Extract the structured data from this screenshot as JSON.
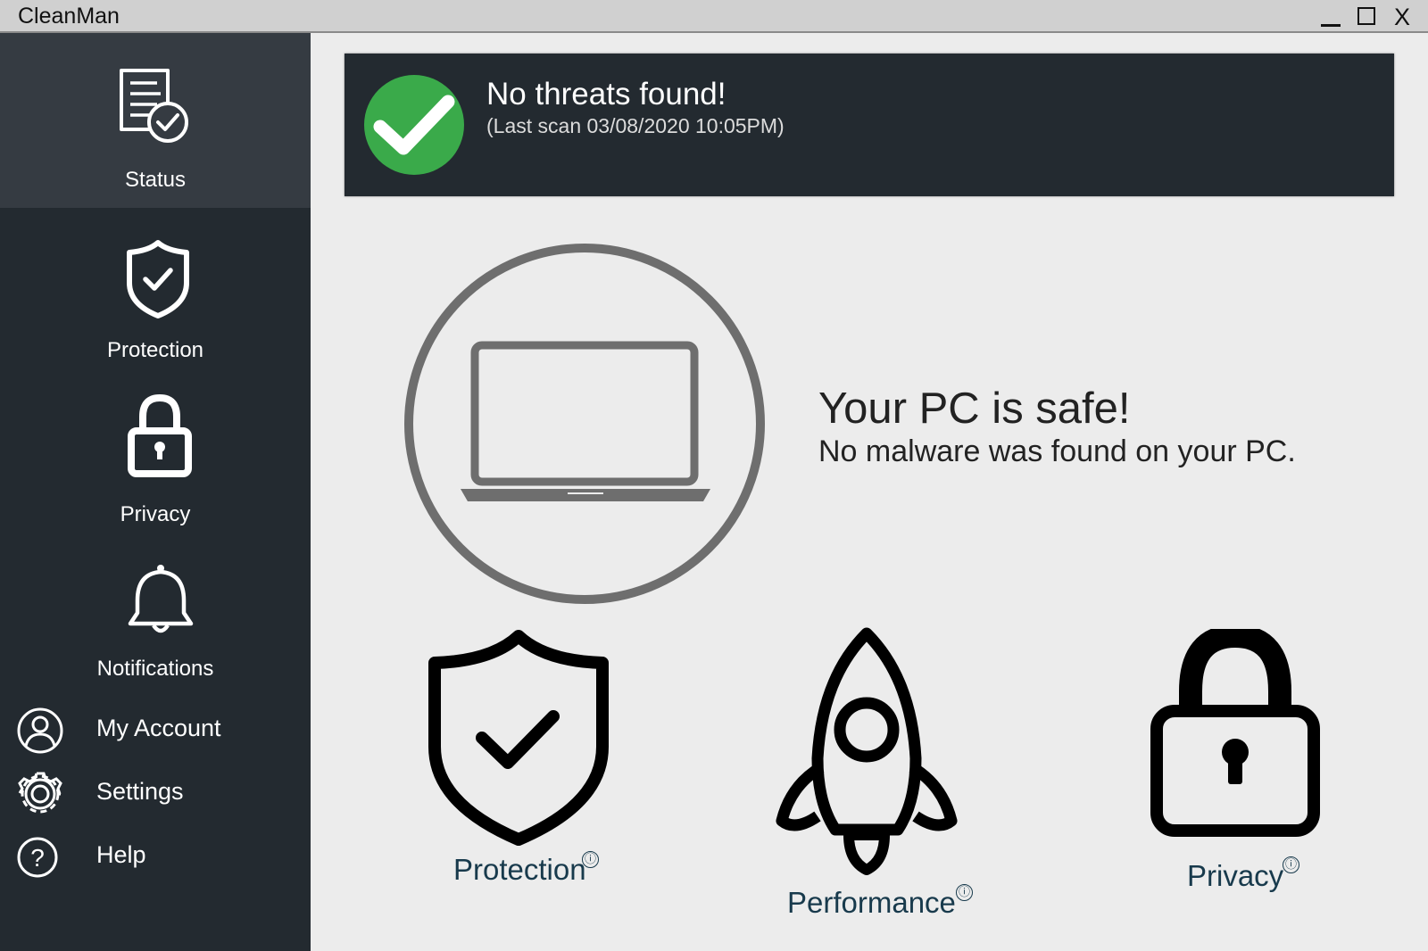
{
  "window": {
    "title": "CleanMan",
    "minimize_icon": "minimize-icon",
    "maximize_icon": "maximize-icon",
    "close_label": "X"
  },
  "sidebar": {
    "items": [
      {
        "label": "Status",
        "icon": "status-report-icon",
        "active": true
      },
      {
        "label": "Protection",
        "icon": "shield-check-icon"
      },
      {
        "label": "Privacy",
        "icon": "padlock-icon"
      },
      {
        "label": "Notifications",
        "icon": "bell-icon"
      },
      {
        "label": "My Account",
        "icon": "user-icon"
      },
      {
        "label": "Settings",
        "icon": "gear-icon"
      },
      {
        "label": "Help",
        "icon": "help-icon"
      }
    ]
  },
  "banner": {
    "title": "No threats found!",
    "subtitle": "(Last scan 03/08/2020 10:05PM)",
    "status_color": "#3aaa4a"
  },
  "hero": {
    "title": "Your PC is safe!",
    "subtitle": "No malware was found on your PC.",
    "icon": "laptop-icon"
  },
  "features": [
    {
      "label": "Protection",
      "icon": "shield-check-icon",
      "info": "ⓘ"
    },
    {
      "label": "Performance",
      "icon": "rocket-icon",
      "info": "ⓘ"
    },
    {
      "label": "Privacy",
      "icon": "padlock-icon",
      "info": "ⓘ"
    }
  ],
  "colors": {
    "sidebar_bg": "#232a30",
    "sidebar_active": "#353b42",
    "content_bg": "#ececec",
    "feature_label": "#183a4c"
  }
}
